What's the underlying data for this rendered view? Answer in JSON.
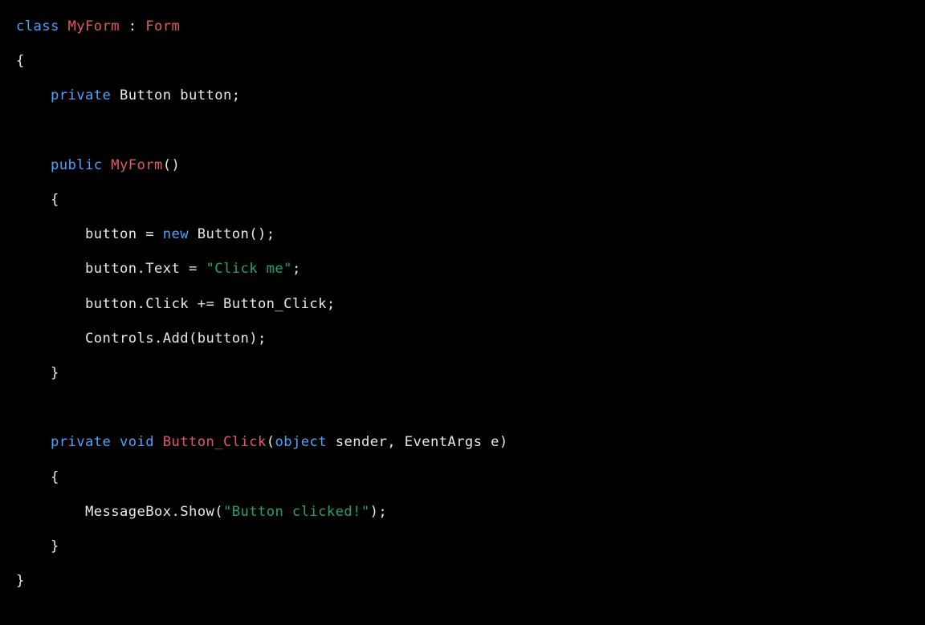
{
  "tokens": {
    "class": "class",
    "MyForm": "MyForm",
    "colon": ":",
    "Form": "Form",
    "lbrace": "{",
    "rbrace": "}",
    "private": "private",
    "Button": "Button",
    "button_decl": "button;",
    "public": "public",
    "ctor_parens": "()",
    "assign_new_pre": "button = ",
    "new": "new",
    "new_button_call": " Button();",
    "text_assign_pre": "button.Text = ",
    "str_click_me": "\"Click me\"",
    "semicolon": ";",
    "click_line": "button.Click += Button_Click;",
    "controls_line": "Controls.Add(button);",
    "void": "void",
    "Button_Click": "Button_Click",
    "lparen": "(",
    "object": "object",
    "sender": " sender, EventArgs e)",
    "msgbox_pre": "MessageBox.Show(",
    "str_clicked": "\"Button clicked!\"",
    "rparen_semi": ");"
  }
}
